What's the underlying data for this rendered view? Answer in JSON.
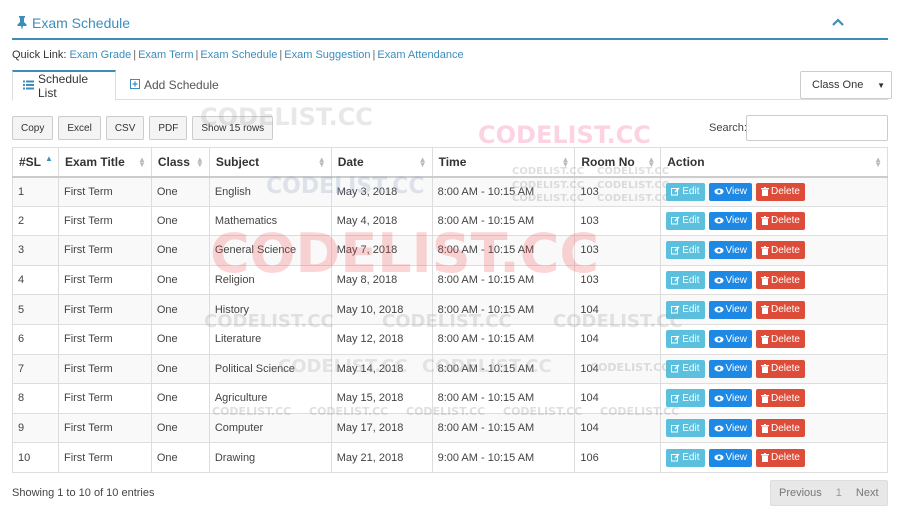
{
  "panel": {
    "title": "Exam Schedule",
    "pin_icon": "pin-icon",
    "collapse_icon": "chevron-up-icon"
  },
  "quick_links": {
    "label": "Quick Link:",
    "items": [
      "Exam Grade",
      "Exam Term",
      "Exam Schedule",
      "Exam Suggestion",
      "Exam Attendance"
    ]
  },
  "tabs": [
    {
      "label": "Schedule List",
      "icon": "list-icon",
      "active": true
    },
    {
      "label": "Add Schedule",
      "icon": "plus-square-icon",
      "active": false
    }
  ],
  "class_filter": {
    "selected": "Class One"
  },
  "toolbar": {
    "buttons": [
      "Copy",
      "Excel",
      "CSV",
      "PDF",
      "Show 15 rows"
    ]
  },
  "search": {
    "label": "Search:",
    "value": ""
  },
  "table": {
    "headers": [
      "#SL",
      "Exam Title",
      "Class",
      "Subject",
      "Date",
      "Time",
      "Room No",
      "Action"
    ],
    "rows": [
      [
        "1",
        "First Term",
        "One",
        "English",
        "May 3, 2018",
        "8:00 AM - 10:15 AM",
        "103"
      ],
      [
        "2",
        "First Term",
        "One",
        "Mathematics",
        "May 4, 2018",
        "8:00 AM - 10:15 AM",
        "103"
      ],
      [
        "3",
        "First Term",
        "One",
        "General Science",
        "May 7, 2018",
        "8:00 AM - 10:15 AM",
        "103"
      ],
      [
        "4",
        "First Term",
        "One",
        "Religion",
        "May 8, 2018",
        "8:00 AM - 10:15 AM",
        "103"
      ],
      [
        "5",
        "First Term",
        "One",
        "History",
        "May 10, 2018",
        "8:00 AM - 10:15 AM",
        "104"
      ],
      [
        "6",
        "First Term",
        "One",
        "Literature",
        "May 12, 2018",
        "8:00 AM - 10:15 AM",
        "104"
      ],
      [
        "7",
        "First Term",
        "One",
        "Political Science",
        "May 14, 2018",
        "8:00 AM - 10:15 AM",
        "104"
      ],
      [
        "8",
        "First Term",
        "One",
        "Agriculture",
        "May 15, 2018",
        "8:00 AM - 10:15 AM",
        "104"
      ],
      [
        "9",
        "First Term",
        "One",
        "Computer",
        "May 17, 2018",
        "8:00 AM - 10:15 AM",
        "104"
      ],
      [
        "10",
        "First Term",
        "One",
        "Drawing",
        "May 21, 2018",
        "9:00 AM - 10:15 AM",
        "106"
      ]
    ],
    "actions": {
      "edit": "Edit",
      "view": "View",
      "delete": "Delete"
    }
  },
  "footer": {
    "info": "Showing 1 to 10 of 10 entries"
  },
  "pagination": {
    "previous": "Previous",
    "current": "1",
    "next": "Next"
  },
  "watermark": {
    "text": "CODELIST.CC"
  },
  "colors": {
    "accent": "#3c8dbc",
    "edit": "#5bc0de",
    "view": "#1e88e5",
    "delete": "#dd4b39"
  }
}
